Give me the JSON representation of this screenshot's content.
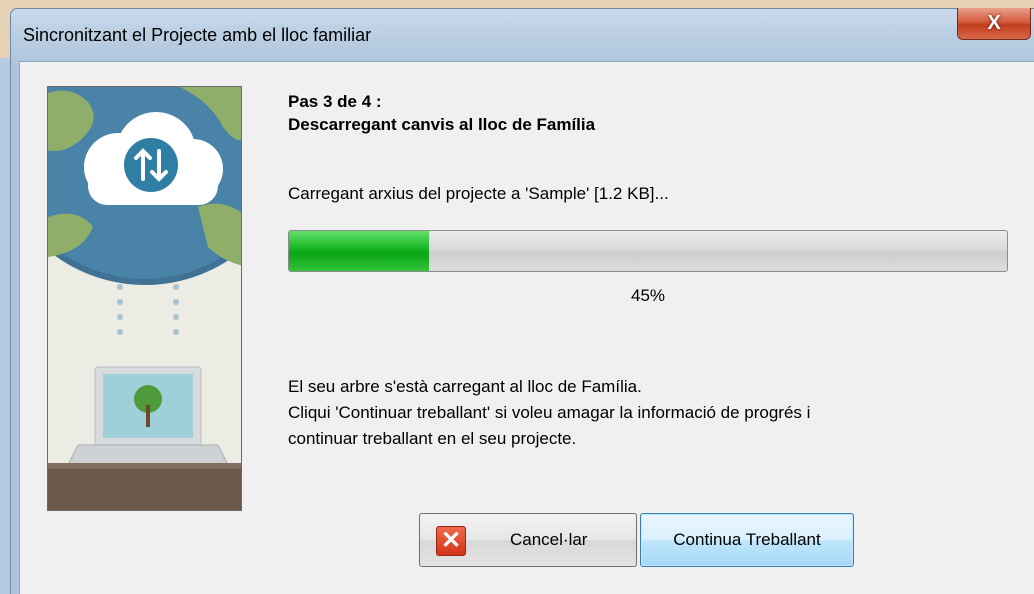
{
  "window": {
    "title": "Sincronitzant el Projecte amb el lloc familiar",
    "close_label": "X"
  },
  "step": {
    "line1": "Pas 3 de 4 :",
    "line2": "Descarregant canvis al lloc de Família"
  },
  "status": "Carregant arxius del projecte a 'Sample' [1.2 KB]...",
  "progress": {
    "fraction": 0.195,
    "percent_label": "45%",
    "fill_color": "#1fb92a"
  },
  "info": {
    "line1": "El seu arbre s'està carregant al lloc de Família.",
    "line2": "Cliqui 'Continuar treballant' si voleu amagar la informació de progrés i",
    "line3": "continuar treballant en el seu projecte."
  },
  "buttons": {
    "cancel_label": "Cancel·lar",
    "cancel_icon": "close-x-icon",
    "continue_label": "Continua Treballant"
  },
  "colors": {
    "title_bar": "#b9cde2",
    "close_button": "#c23d1e",
    "focus_button": "#3c7fb1"
  }
}
